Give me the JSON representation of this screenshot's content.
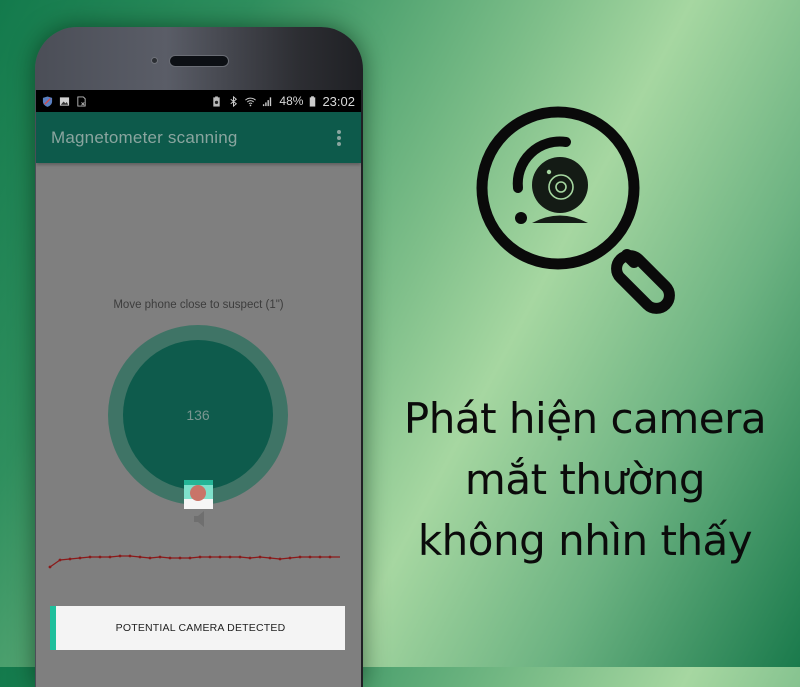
{
  "status_bar": {
    "left_icons": [
      "shield-icon",
      "image-icon",
      "sim-icon"
    ],
    "right_icons": [
      "battery-saver-icon",
      "bluetooth-icon",
      "wifi-icon",
      "signal-icon"
    ],
    "battery_percent": "48%",
    "time": "23:02"
  },
  "app_bar": {
    "title": "Magnetometer scanning",
    "menu_icon": "more-vert-icon"
  },
  "scanner": {
    "instruction": "Move phone close to suspect (1\")",
    "reading": "136",
    "indicator_icon": "record-dot-icon",
    "sound_icon": "speaker-icon"
  },
  "alert": {
    "message": "POTENTIAL CAMERA DETECTED"
  },
  "promo": {
    "icon": "magnifier-camera-icon",
    "headline_lines": [
      "Phát hiện camera",
      "mắt thường",
      "không nhìn thấy"
    ]
  },
  "colors": {
    "app_bar": "#0d5a4b",
    "accent": "#1fbf9c",
    "alert_dot": "#c97468",
    "graph_line": "#8b1a1a"
  }
}
